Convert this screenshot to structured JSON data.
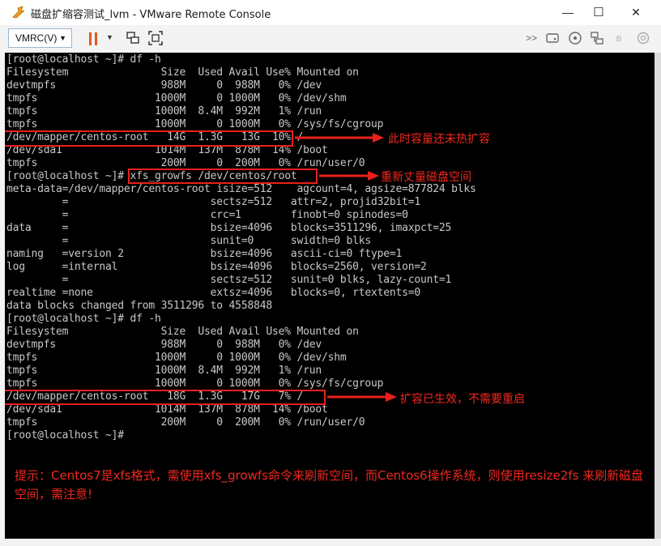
{
  "window": {
    "title": "磁盘扩缩容测试_lvm - VMware Remote Console",
    "minimize_glyph": "—",
    "maximize_glyph": "☐",
    "close_glyph": "✕"
  },
  "toolbar": {
    "vmrc_label": "VMRC(V)",
    "vmrc_arrow": "▼",
    "power_dropdown_glyph": "▼",
    "right_icons": [
      "fast-forward-icon",
      "hard-disk-icon",
      "cd-rom-icon",
      "network-icon",
      "bluetooth-icon",
      "audio-icon"
    ]
  },
  "terminal": {
    "lines": [
      "[root@localhost ~]# df -h",
      "Filesystem               Size  Used Avail Use% Mounted on",
      "devtmpfs                 988M     0  988M   0% /dev",
      "tmpfs                   1000M     0 1000M   0% /dev/shm",
      "tmpfs                   1000M  8.4M  992M   1% /run",
      "tmpfs                   1000M     0 1000M   0% /sys/fs/cgroup",
      "/dev/mapper/centos-root   14G  1.3G   13G  10% /",
      "/dev/sda1               1014M  137M  878M  14% /boot",
      "tmpfs                    200M     0  200M   0% /run/user/0",
      "[root@localhost ~]# xfs_growfs /dev/centos/root",
      "meta-data=/dev/mapper/centos-root isize=512    agcount=4, agsize=877824 blks",
      "         =                       sectsz=512   attr=2, projid32bit=1",
      "         =                       crc=1        finobt=0 spinodes=0",
      "data     =                       bsize=4096   blocks=3511296, imaxpct=25",
      "         =                       sunit=0      swidth=0 blks",
      "naming   =version 2              bsize=4096   ascii-ci=0 ftype=1",
      "log      =internal               bsize=4096   blocks=2560, version=2",
      "         =                       sectsz=512   sunit=0 blks, lazy-count=1",
      "realtime =none                   extsz=4096   blocks=0, rtextents=0",
      "data blocks changed from 3511296 to 4558848",
      "[root@localhost ~]# df -h",
      "Filesystem               Size  Used Avail Use% Mounted on",
      "devtmpfs                 988M     0  988M   0% /dev",
      "tmpfs                   1000M     0 1000M   0% /dev/shm",
      "tmpfs                   1000M  8.4M  992M   1% /run",
      "tmpfs                   1000M     0 1000M   0% /sys/fs/cgroup",
      "/dev/mapper/centos-root   18G  1.3G   17G   7% /",
      "/dev/sda1               1014M  137M  878M  14% /boot",
      "tmpfs                    200M     0  200M   0% /run/user/0",
      "[root@localhost ~]#"
    ]
  },
  "annotations": {
    "note1": "此时容量还未热扩容",
    "note2": "重新丈量磁盘空间",
    "note3": "扩容已生效，不需要重启",
    "tip": "提示：Centos7是xfs格式，需使用xfs_growfs命令来刷新空间，而Centos6操作系统，则使用resize2fs 来刷新磁盘空间，需注意!",
    "accent_color": "#e8201a"
  }
}
